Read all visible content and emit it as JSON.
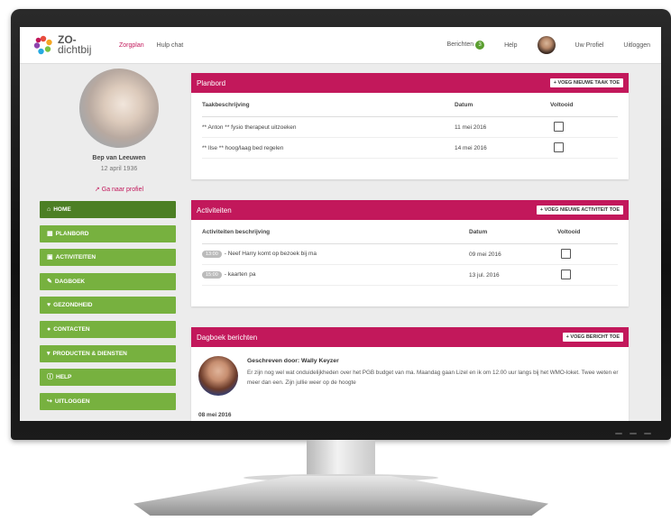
{
  "logo": {
    "line1": "ZO-",
    "line2": "dichtbij"
  },
  "nav": {
    "zorgplan": "Zorgplan",
    "hulpchat": "Hulp chat",
    "berichten": "Berichten",
    "berichten_count": "3",
    "help": "Help",
    "profiel": "Uw Profiel",
    "uitloggen": "Uitloggen"
  },
  "profile": {
    "name": "Bep van Leeuwen",
    "date": "12 april 1936",
    "link": "Ga naar profiel"
  },
  "menu": [
    {
      "label": "HOME",
      "icon": "home-icon"
    },
    {
      "label": "PLANBORD",
      "icon": "grid-icon"
    },
    {
      "label": "ACTIVITEITEN",
      "icon": "camera-icon"
    },
    {
      "label": "DAGBOEK",
      "icon": "book-icon"
    },
    {
      "label": "GEZONDHEID",
      "icon": "heart-icon"
    },
    {
      "label": "CONTACTEN",
      "icon": "user-icon"
    },
    {
      "label": "PRODUCTEN & DIENSTEN",
      "icon": "cart-icon"
    },
    {
      "label": "HELP",
      "icon": "question-icon"
    },
    {
      "label": "UITLOGGEN",
      "icon": "logout-icon"
    }
  ],
  "planbord": {
    "title": "Planbord",
    "button": "+ VOEG NIEUWE TAAK TOE",
    "headers": [
      "Taakbeschrijving",
      "Datum",
      "Voltooid"
    ],
    "rows": [
      {
        "desc": "** Anton ** fysio therapeut uitzoeken",
        "date": "11 mei 2016"
      },
      {
        "desc": "** Ilse ** hoog/laag bed regelen",
        "date": "14 mei 2016"
      }
    ]
  },
  "activiteiten": {
    "title": "Activiteiten",
    "button": "+ VOEG NIEUWE ACTIVITEIT TOE",
    "headers": [
      "Activiteiten beschrijving",
      "Datum",
      "Voltooid"
    ],
    "rows": [
      {
        "time": "13:00",
        "desc": "- Neef Harry komt op bezoek bij ma",
        "date": "09 mei 2016"
      },
      {
        "time": "15:00",
        "desc": "- kaarten pa",
        "date": "13 jul. 2016"
      }
    ]
  },
  "dagboek": {
    "title": "Dagboek berichten",
    "button": "+ VOEG BERICHT TOE",
    "author": "Geschreven door: Wally Keyzer",
    "text": "Er zijn nog wel wat onduidelijkheden over het PGB budget van ma. Maandag gaan Lizel en ik om 12.00 uur langs bij het WMO-loket. Twee weten er meer dan een. Zijn jullie weer op de hoogte",
    "date": "08 mei 2016"
  },
  "colors": {
    "accent": "#c2185b",
    "menu_green": "#77b13f",
    "menu_active": "#4c7f24"
  }
}
